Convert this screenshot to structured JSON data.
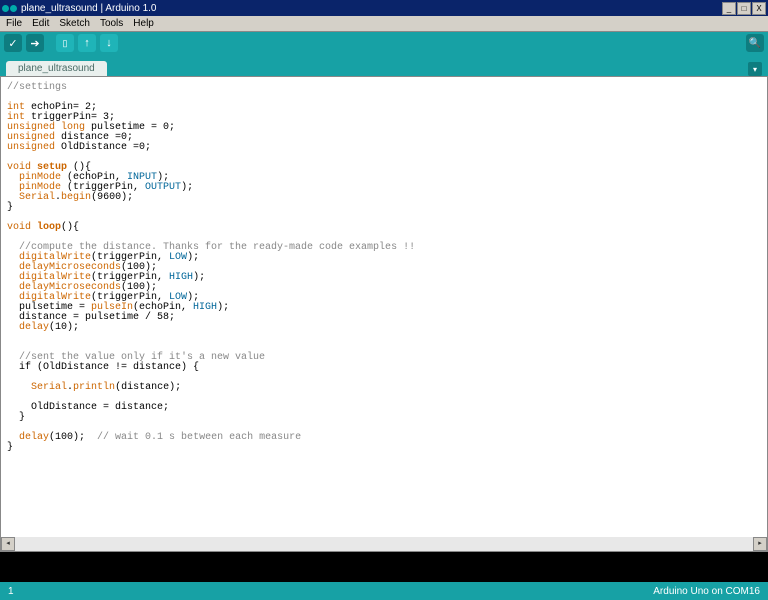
{
  "title": "plane_ultrasound | Arduino 1.0",
  "menu": {
    "file": "File",
    "edit": "Edit",
    "sketch": "Sketch",
    "tools": "Tools",
    "help": "Help"
  },
  "winbtns": {
    "min": "_",
    "max": "□",
    "close": "X"
  },
  "tab": {
    "name": "plane_ultrasound"
  },
  "status": {
    "line": "1",
    "board": "Arduino Uno on COM16"
  },
  "code": {
    "l1": "//settings",
    "l3a": "int",
    "l3b": " echoPin= 2;",
    "l4a": "int",
    "l4b": " triggerPin= 3;",
    "l5a": "unsigned long",
    "l5b": " pulsetime = 0;",
    "l6a": "unsigned",
    "l6b": " distance =0;",
    "l7a": "unsigned",
    "l7b": " OldDistance =0;",
    "l9a": "void",
    "l9b": "setup",
    "l9c": " (){",
    "l10a": "  ",
    "l10b": "pinMode",
    "l10c": " (echoPin, ",
    "l10d": "INPUT",
    "l10e": ");",
    "l11a": "  ",
    "l11b": "pinMode",
    "l11c": " (triggerPin, ",
    "l11d": "OUTPUT",
    "l11e": ");",
    "l12a": "  ",
    "l12b": "Serial",
    "l12c": ".",
    "l12d": "begin",
    "l12e": "(9600);",
    "l13": "}",
    "l15a": "void",
    "l15b": "loop",
    "l15c": "(){",
    "l17": "  //compute the distance. Thanks for the ready-made code examples !!",
    "l18a": "  ",
    "l18b": "digitalWrite",
    "l18c": "(triggerPin, ",
    "l18d": "LOW",
    "l18e": ");",
    "l19a": "  ",
    "l19b": "delayMicroseconds",
    "l19c": "(100);",
    "l20a": "  ",
    "l20b": "digitalWrite",
    "l20c": "(triggerPin, ",
    "l20d": "HIGH",
    "l20e": ");",
    "l21a": "  ",
    "l21b": "delayMicroseconds",
    "l21c": "(100);",
    "l22a": "  ",
    "l22b": "digitalWrite",
    "l22c": "(triggerPin, ",
    "l22d": "LOW",
    "l22e": ");",
    "l23a": "  pulsetime = ",
    "l23b": "pulseIn",
    "l23c": "(echoPin, ",
    "l23d": "HIGH",
    "l23e": ");",
    "l24": "  distance = pulsetime / 58;",
    "l25a": "  ",
    "l25b": "delay",
    "l25c": "(10);",
    "l28": "  //sent the value only if it's a new value",
    "l29": "  if (OldDistance != distance) {",
    "l31a": "    ",
    "l31b": "Serial",
    "l31c": ".",
    "l31d": "println",
    "l31e": "(distance);",
    "l33": "    OldDistance = distance;",
    "l34": "  }",
    "l36a": "  ",
    "l36b": "delay",
    "l36c": "(100);  ",
    "l36d": "// wait 0.1 s between each measure",
    "l37": "}"
  }
}
